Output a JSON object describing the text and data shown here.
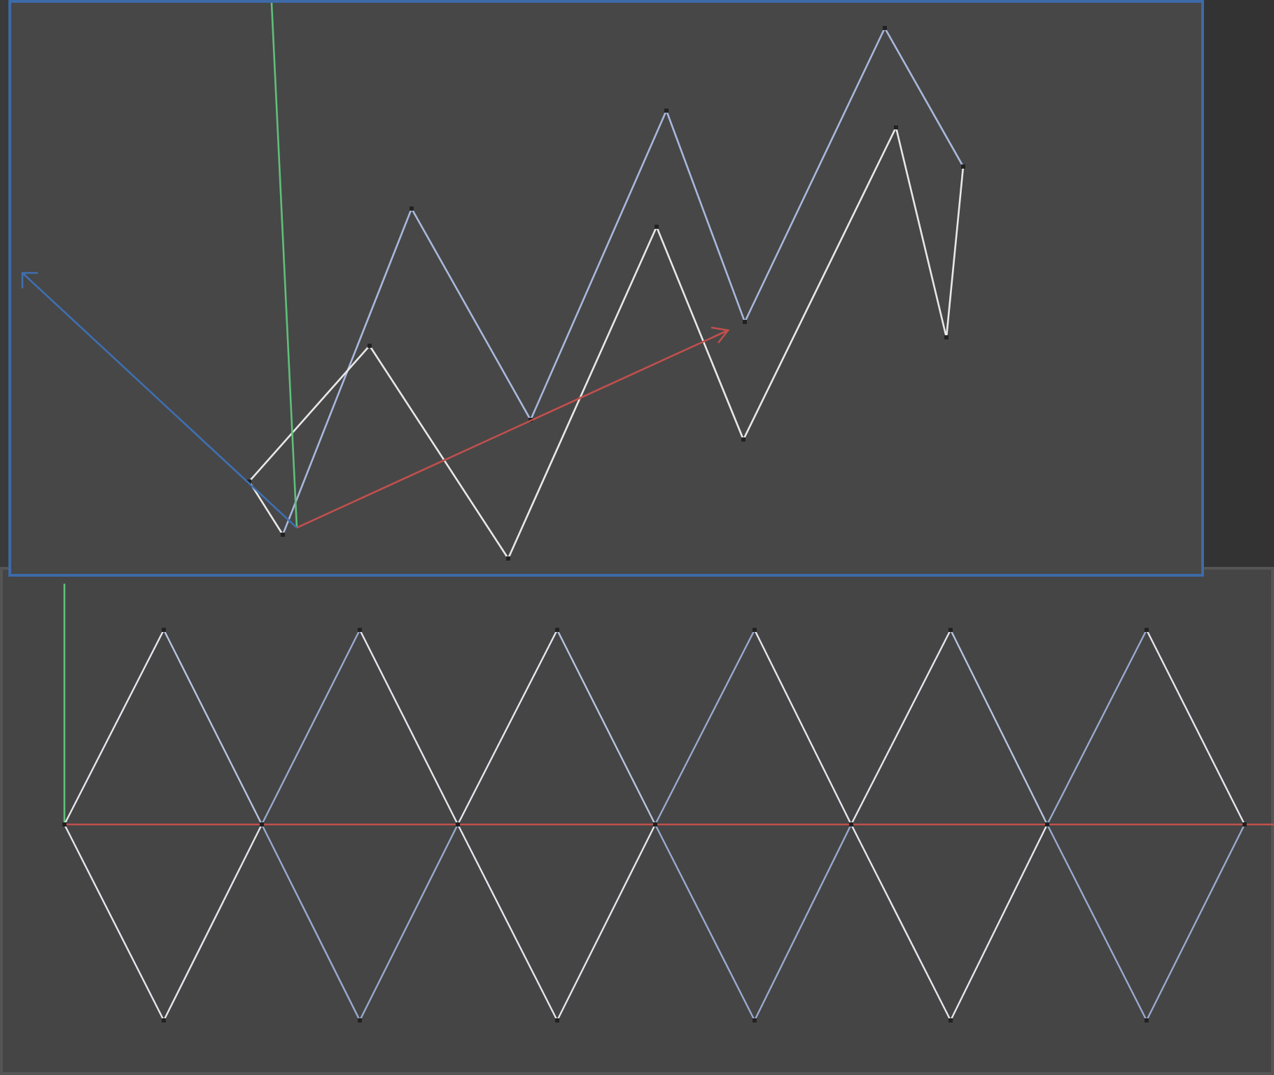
{
  "viewports": [
    {
      "kind": "perspective",
      "selected": true
    },
    {
      "kind": "front",
      "selected": false
    }
  ]
}
